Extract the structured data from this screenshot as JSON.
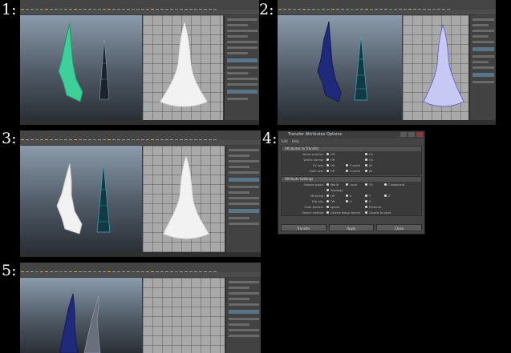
{
  "panel_numbers": [
    "1:",
    "2:",
    "3:",
    "4:",
    "5:"
  ],
  "icons": [
    "maya-shelf-icon",
    "viewport-icon",
    "gear-icon"
  ],
  "colors": {
    "background": "#000000",
    "green_mesh": "#3fcf9a",
    "blue_mesh": "#1f2a7a",
    "white_mesh": "#f2f2f2",
    "wire_cyan": "#4aa9b8"
  },
  "dialog": {
    "title": "Transfer Attributes Options",
    "menu": [
      "Edit",
      "Help"
    ],
    "section_attributes": "Attributes to Transfer",
    "section_settings": "Attribute Settings",
    "attr_rows": [
      {
        "label": "Vertex position",
        "a": "Off",
        "b": "On"
      },
      {
        "label": "Vertex normal",
        "a": "Off",
        "b": "On"
      },
      {
        "label": "UV sets",
        "a": "Off",
        "b": "Current",
        "c": "All"
      },
      {
        "label": "Color sets",
        "a": "Off",
        "b": "Current",
        "c": "All"
      }
    ],
    "setting_rows": [
      {
        "label": "Sample space",
        "a": "World",
        "b": "Local",
        "c": "UV",
        "d": "Component"
      },
      {
        "label": "",
        "a": "Topology"
      },
      {
        "label": "Mirroring",
        "a": "Off",
        "b": "X",
        "c": "Y",
        "d": "Z"
      },
      {
        "label": "Flip UVs",
        "a": "Off",
        "b": "U",
        "c": "V"
      },
      {
        "label": "Color borders",
        "a": "Ignore",
        "b": "Preserve"
      },
      {
        "label": "Search method",
        "a": "Closest along normal",
        "b": "Closest to point"
      }
    ],
    "buttons": [
      "Transfer",
      "Apply",
      "Close"
    ]
  }
}
